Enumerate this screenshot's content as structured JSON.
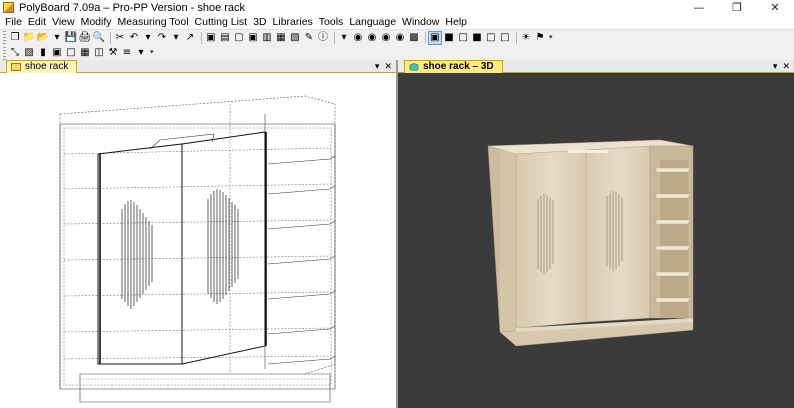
{
  "window": {
    "title": "PolyBoard 7.09a – Pro-PP Version - shoe rack",
    "controls": {
      "minimize": "—",
      "restore": "❐",
      "close": "✕"
    }
  },
  "menu": {
    "items": [
      "File",
      "Edit",
      "View",
      "Modify",
      "Measuring Tool",
      "Cutting List",
      "3D",
      "Libraries",
      "Tools",
      "Language",
      "Window",
      "Help"
    ]
  },
  "toolbar1": {
    "icons": [
      "new-file-icon",
      "new-folder-icon",
      "open-folder-icon",
      "more-arrow-icon",
      "save-icon",
      "print-icon",
      "print-preview-icon",
      "cut-icon",
      "undo-icon",
      "undo-arrow-icon",
      "redo-icon",
      "redo-arrow-icon",
      "export-icon",
      "cube-icon",
      "shaded-box-icon",
      "open-box-icon",
      "double-box-icon",
      "panel-icon",
      "stack-icon",
      "stack-copy-icon",
      "pencil-icon",
      "info-icon",
      "info-arrow-icon",
      "globe-icon",
      "globe-2-icon",
      "globe-3-icon",
      "globe-4-icon",
      "logo-icon",
      "view-front-icon",
      "view-green-icon",
      "view-box-icon",
      "view-green-box-icon",
      "view-outline-icon",
      "view-outline-2-icon",
      "lightbulb-icon",
      "tag-icon"
    ],
    "glyphs": [
      "❐",
      "📁",
      "📂",
      "▾",
      "💾",
      "🖨",
      "🔍",
      "✂",
      "↶",
      "▾",
      "↷",
      "▾",
      "↗",
      "▣",
      "▤",
      "▢",
      "▣",
      "▥",
      "▦",
      "▧",
      "✎",
      "ⓘ",
      "▾",
      "◉",
      "◉",
      "◉",
      "◉",
      "▩",
      "▣",
      "■",
      "□",
      "■",
      "□",
      "□",
      "☀",
      "⚑"
    ]
  },
  "toolbar2": {
    "icons": [
      "measure-icon",
      "select-tool-icon",
      "panel-red-icon",
      "panel-frame-icon",
      "panel-outline-icon",
      "grid-icon",
      "split-icon",
      "hammer-icon",
      "lines-icon",
      "arrow-down-icon"
    ],
    "glyphs": [
      "⤡",
      "▧",
      "▮",
      "▣",
      "□",
      "▦",
      "◫",
      "⚒",
      "≡",
      "▾"
    ]
  },
  "left_pane": {
    "tab_label": "shoe rack",
    "ctrl_menu": "▾",
    "ctrl_close": "✕"
  },
  "right_pane": {
    "tab_label": "shoe rack – 3D",
    "ctrl_menu": "▾",
    "ctrl_close": "✕"
  },
  "colors": {
    "viewport_dark": "#3b3b3b",
    "wood": "#e4d7c3",
    "tab_yellow": "#fff4b8"
  }
}
